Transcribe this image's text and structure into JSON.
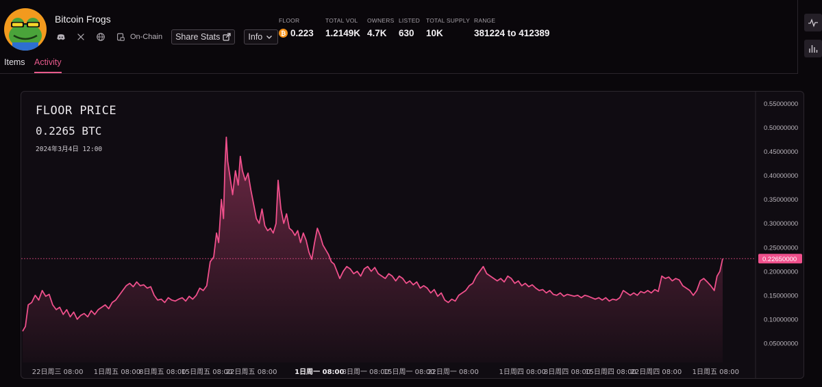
{
  "collection": {
    "name": "Bitcoin Frogs",
    "avatar_icon": "frog-avatar-icon",
    "onchain_label": "On-Chain",
    "share_label": "Share Stats",
    "info_label": "Info"
  },
  "stats": [
    {
      "label": "FLOOR",
      "value": "0.223",
      "icon": "bitcoin-icon"
    },
    {
      "label": "TOTAL VOL",
      "value": "1.2149K"
    },
    {
      "label": "OWNERS",
      "value": "4.7K"
    },
    {
      "label": "LISTED",
      "value": "630"
    },
    {
      "label": "TOTAL SUPPLY",
      "value": "10K"
    },
    {
      "label": "RANGE",
      "value": "381224 to 412389"
    }
  ],
  "tabs": [
    {
      "label": "Items",
      "active": false
    },
    {
      "label": "Activity",
      "active": true
    }
  ],
  "colors": {
    "accent": "#e85a8c",
    "line": "#f0508c",
    "bitcoin": "#f7931a"
  },
  "chart_data": {
    "type": "area",
    "title": "FLOOR PRICE",
    "current_value": "0.2265 BTC",
    "current_date": "2024年3月4日 12:00",
    "current_marker": 0.2265,
    "current_marker_label": "0.22650000",
    "ylim": [
      0.01,
      0.575
    ],
    "y_ticks": [
      0.05,
      0.1,
      0.15,
      0.2,
      0.25,
      0.3,
      0.35,
      0.4,
      0.45,
      0.5,
      0.55
    ],
    "y_tick_labels": [
      "0.05000000",
      "0.10000000",
      "0.15000000",
      "0.20000000",
      "0.25000000",
      "0.30000000",
      "0.35000000",
      "0.40000000",
      "0.45000000",
      "0.50000000",
      "0.55000000"
    ],
    "x_ticks": [
      {
        "label": "22日周三 08:00",
        "t": 0.05,
        "bold": false
      },
      {
        "label": "1日周五 08:00",
        "t": 0.135,
        "bold": false
      },
      {
        "label": "8日周五 08:00",
        "t": 0.2,
        "bold": false
      },
      {
        "label": "15日周五 08:00",
        "t": 0.263,
        "bold": false
      },
      {
        "label": "22日周五 08:00",
        "t": 0.327,
        "bold": false
      },
      {
        "label": "1日周一 08:00",
        "t": 0.424,
        "bold": true
      },
      {
        "label": "8日周一 08:00",
        "t": 0.49,
        "bold": false
      },
      {
        "label": "15日周一 08:00",
        "t": 0.552,
        "bold": false
      },
      {
        "label": "22日周一 08:00",
        "t": 0.615,
        "bold": false
      },
      {
        "label": "1日周四 08:00",
        "t": 0.714,
        "bold": false
      },
      {
        "label": "8日周四 08:00",
        "t": 0.778,
        "bold": false
      },
      {
        "label": "15日周四 08:00",
        "t": 0.84,
        "bold": false
      },
      {
        "label": "22日周四 08:00",
        "t": 0.905,
        "bold": false
      },
      {
        "label": "1日周五 08:00",
        "t": 0.99,
        "bold": false
      }
    ],
    "series": [
      {
        "points": [
          [
            0.0,
            0.075
          ],
          [
            0.004,
            0.085
          ],
          [
            0.008,
            0.13
          ],
          [
            0.013,
            0.135
          ],
          [
            0.018,
            0.15
          ],
          [
            0.023,
            0.14
          ],
          [
            0.028,
            0.16
          ],
          [
            0.033,
            0.148
          ],
          [
            0.038,
            0.152
          ],
          [
            0.043,
            0.13
          ],
          [
            0.048,
            0.12
          ],
          [
            0.053,
            0.125
          ],
          [
            0.058,
            0.11
          ],
          [
            0.063,
            0.12
          ],
          [
            0.068,
            0.105
          ],
          [
            0.073,
            0.115
          ],
          [
            0.078,
            0.1
          ],
          [
            0.083,
            0.108
          ],
          [
            0.088,
            0.112
          ],
          [
            0.093,
            0.105
          ],
          [
            0.098,
            0.118
          ],
          [
            0.103,
            0.11
          ],
          [
            0.108,
            0.12
          ],
          [
            0.113,
            0.125
          ],
          [
            0.118,
            0.13
          ],
          [
            0.123,
            0.122
          ],
          [
            0.128,
            0.135
          ],
          [
            0.133,
            0.14
          ],
          [
            0.138,
            0.15
          ],
          [
            0.143,
            0.16
          ],
          [
            0.148,
            0.17
          ],
          [
            0.153,
            0.175
          ],
          [
            0.158,
            0.168
          ],
          [
            0.163,
            0.178
          ],
          [
            0.168,
            0.17
          ],
          [
            0.173,
            0.172
          ],
          [
            0.178,
            0.165
          ],
          [
            0.183,
            0.168
          ],
          [
            0.188,
            0.15
          ],
          [
            0.193,
            0.14
          ],
          [
            0.198,
            0.142
          ],
          [
            0.203,
            0.135
          ],
          [
            0.208,
            0.145
          ],
          [
            0.213,
            0.14
          ],
          [
            0.218,
            0.138
          ],
          [
            0.223,
            0.142
          ],
          [
            0.228,
            0.145
          ],
          [
            0.233,
            0.138
          ],
          [
            0.238,
            0.148
          ],
          [
            0.243,
            0.142
          ],
          [
            0.248,
            0.15
          ],
          [
            0.253,
            0.165
          ],
          [
            0.258,
            0.16
          ],
          [
            0.263,
            0.17
          ],
          [
            0.268,
            0.22
          ],
          [
            0.273,
            0.23
          ],
          [
            0.277,
            0.28
          ],
          [
            0.28,
            0.26
          ],
          [
            0.284,
            0.35
          ],
          [
            0.287,
            0.31
          ],
          [
            0.289,
            0.42
          ],
          [
            0.291,
            0.48
          ],
          [
            0.293,
            0.43
          ],
          [
            0.296,
            0.4
          ],
          [
            0.3,
            0.36
          ],
          [
            0.304,
            0.41
          ],
          [
            0.308,
            0.38
          ],
          [
            0.311,
            0.44
          ],
          [
            0.314,
            0.41
          ],
          [
            0.318,
            0.39
          ],
          [
            0.322,
            0.405
          ],
          [
            0.326,
            0.37
          ],
          [
            0.33,
            0.34
          ],
          [
            0.334,
            0.31
          ],
          [
            0.338,
            0.3
          ],
          [
            0.342,
            0.33
          ],
          [
            0.346,
            0.295
          ],
          [
            0.35,
            0.285
          ],
          [
            0.354,
            0.29
          ],
          [
            0.358,
            0.28
          ],
          [
            0.362,
            0.3
          ],
          [
            0.365,
            0.39
          ],
          [
            0.369,
            0.33
          ],
          [
            0.373,
            0.3
          ],
          [
            0.377,
            0.32
          ],
          [
            0.381,
            0.29
          ],
          [
            0.385,
            0.285
          ],
          [
            0.389,
            0.275
          ],
          [
            0.393,
            0.285
          ],
          [
            0.397,
            0.26
          ],
          [
            0.401,
            0.28
          ],
          [
            0.405,
            0.265
          ],
          [
            0.409,
            0.24
          ],
          [
            0.413,
            0.225
          ],
          [
            0.417,
            0.26
          ],
          [
            0.421,
            0.29
          ],
          [
            0.425,
            0.275
          ],
          [
            0.429,
            0.255
          ],
          [
            0.433,
            0.245
          ],
          [
            0.437,
            0.235
          ],
          [
            0.441,
            0.22
          ],
          [
            0.445,
            0.215
          ],
          [
            0.449,
            0.2
          ],
          [
            0.453,
            0.185
          ],
          [
            0.458,
            0.2
          ],
          [
            0.463,
            0.21
          ],
          [
            0.468,
            0.205
          ],
          [
            0.473,
            0.195
          ],
          [
            0.478,
            0.2
          ],
          [
            0.483,
            0.19
          ],
          [
            0.488,
            0.205
          ],
          [
            0.493,
            0.21
          ],
          [
            0.498,
            0.2
          ],
          [
            0.503,
            0.208
          ],
          [
            0.508,
            0.195
          ],
          [
            0.513,
            0.19
          ],
          [
            0.518,
            0.185
          ],
          [
            0.523,
            0.195
          ],
          [
            0.528,
            0.19
          ],
          [
            0.533,
            0.18
          ],
          [
            0.538,
            0.19
          ],
          [
            0.543,
            0.185
          ],
          [
            0.548,
            0.175
          ],
          [
            0.553,
            0.18
          ],
          [
            0.558,
            0.172
          ],
          [
            0.563,
            0.178
          ],
          [
            0.568,
            0.165
          ],
          [
            0.573,
            0.17
          ],
          [
            0.578,
            0.165
          ],
          [
            0.583,
            0.155
          ],
          [
            0.588,
            0.162
          ],
          [
            0.593,
            0.148
          ],
          [
            0.598,
            0.155
          ],
          [
            0.603,
            0.14
          ],
          [
            0.608,
            0.135
          ],
          [
            0.613,
            0.142
          ],
          [
            0.618,
            0.138
          ],
          [
            0.623,
            0.15
          ],
          [
            0.628,
            0.155
          ],
          [
            0.633,
            0.16
          ],
          [
            0.638,
            0.17
          ],
          [
            0.643,
            0.175
          ],
          [
            0.648,
            0.19
          ],
          [
            0.653,
            0.2
          ],
          [
            0.658,
            0.21
          ],
          [
            0.663,
            0.195
          ],
          [
            0.668,
            0.19
          ],
          [
            0.673,
            0.185
          ],
          [
            0.678,
            0.18
          ],
          [
            0.683,
            0.185
          ],
          [
            0.688,
            0.178
          ],
          [
            0.693,
            0.19
          ],
          [
            0.698,
            0.185
          ],
          [
            0.703,
            0.175
          ],
          [
            0.708,
            0.18
          ],
          [
            0.713,
            0.17
          ],
          [
            0.718,
            0.175
          ],
          [
            0.723,
            0.168
          ],
          [
            0.728,
            0.172
          ],
          [
            0.733,
            0.165
          ],
          [
            0.738,
            0.16
          ],
          [
            0.743,
            0.162
          ],
          [
            0.748,
            0.155
          ],
          [
            0.753,
            0.16
          ],
          [
            0.758,
            0.152
          ],
          [
            0.763,
            0.15
          ],
          [
            0.768,
            0.155
          ],
          [
            0.773,
            0.148
          ],
          [
            0.778,
            0.152
          ],
          [
            0.783,
            0.15
          ],
          [
            0.788,
            0.148
          ],
          [
            0.793,
            0.15
          ],
          [
            0.798,
            0.145
          ],
          [
            0.803,
            0.15
          ],
          [
            0.808,
            0.148
          ],
          [
            0.813,
            0.145
          ],
          [
            0.818,
            0.142
          ],
          [
            0.823,
            0.145
          ],
          [
            0.828,
            0.14
          ],
          [
            0.833,
            0.145
          ],
          [
            0.838,
            0.138
          ],
          [
            0.843,
            0.142
          ],
          [
            0.848,
            0.14
          ],
          [
            0.853,
            0.145
          ],
          [
            0.858,
            0.16
          ],
          [
            0.863,
            0.155
          ],
          [
            0.868,
            0.15
          ],
          [
            0.873,
            0.155
          ],
          [
            0.878,
            0.15
          ],
          [
            0.883,
            0.158
          ],
          [
            0.888,
            0.155
          ],
          [
            0.893,
            0.16
          ],
          [
            0.898,
            0.155
          ],
          [
            0.903,
            0.162
          ],
          [
            0.908,
            0.158
          ],
          [
            0.913,
            0.19
          ],
          [
            0.918,
            0.185
          ],
          [
            0.923,
            0.188
          ],
          [
            0.928,
            0.18
          ],
          [
            0.933,
            0.185
          ],
          [
            0.938,
            0.182
          ],
          [
            0.943,
            0.17
          ],
          [
            0.948,
            0.165
          ],
          [
            0.953,
            0.16
          ],
          [
            0.958,
            0.15
          ],
          [
            0.963,
            0.16
          ],
          [
            0.968,
            0.18
          ],
          [
            0.973,
            0.185
          ],
          [
            0.978,
            0.178
          ],
          [
            0.983,
            0.17
          ],
          [
            0.988,
            0.16
          ],
          [
            0.992,
            0.19
          ],
          [
            0.996,
            0.2
          ],
          [
            1.0,
            0.2265
          ]
        ]
      }
    ]
  }
}
